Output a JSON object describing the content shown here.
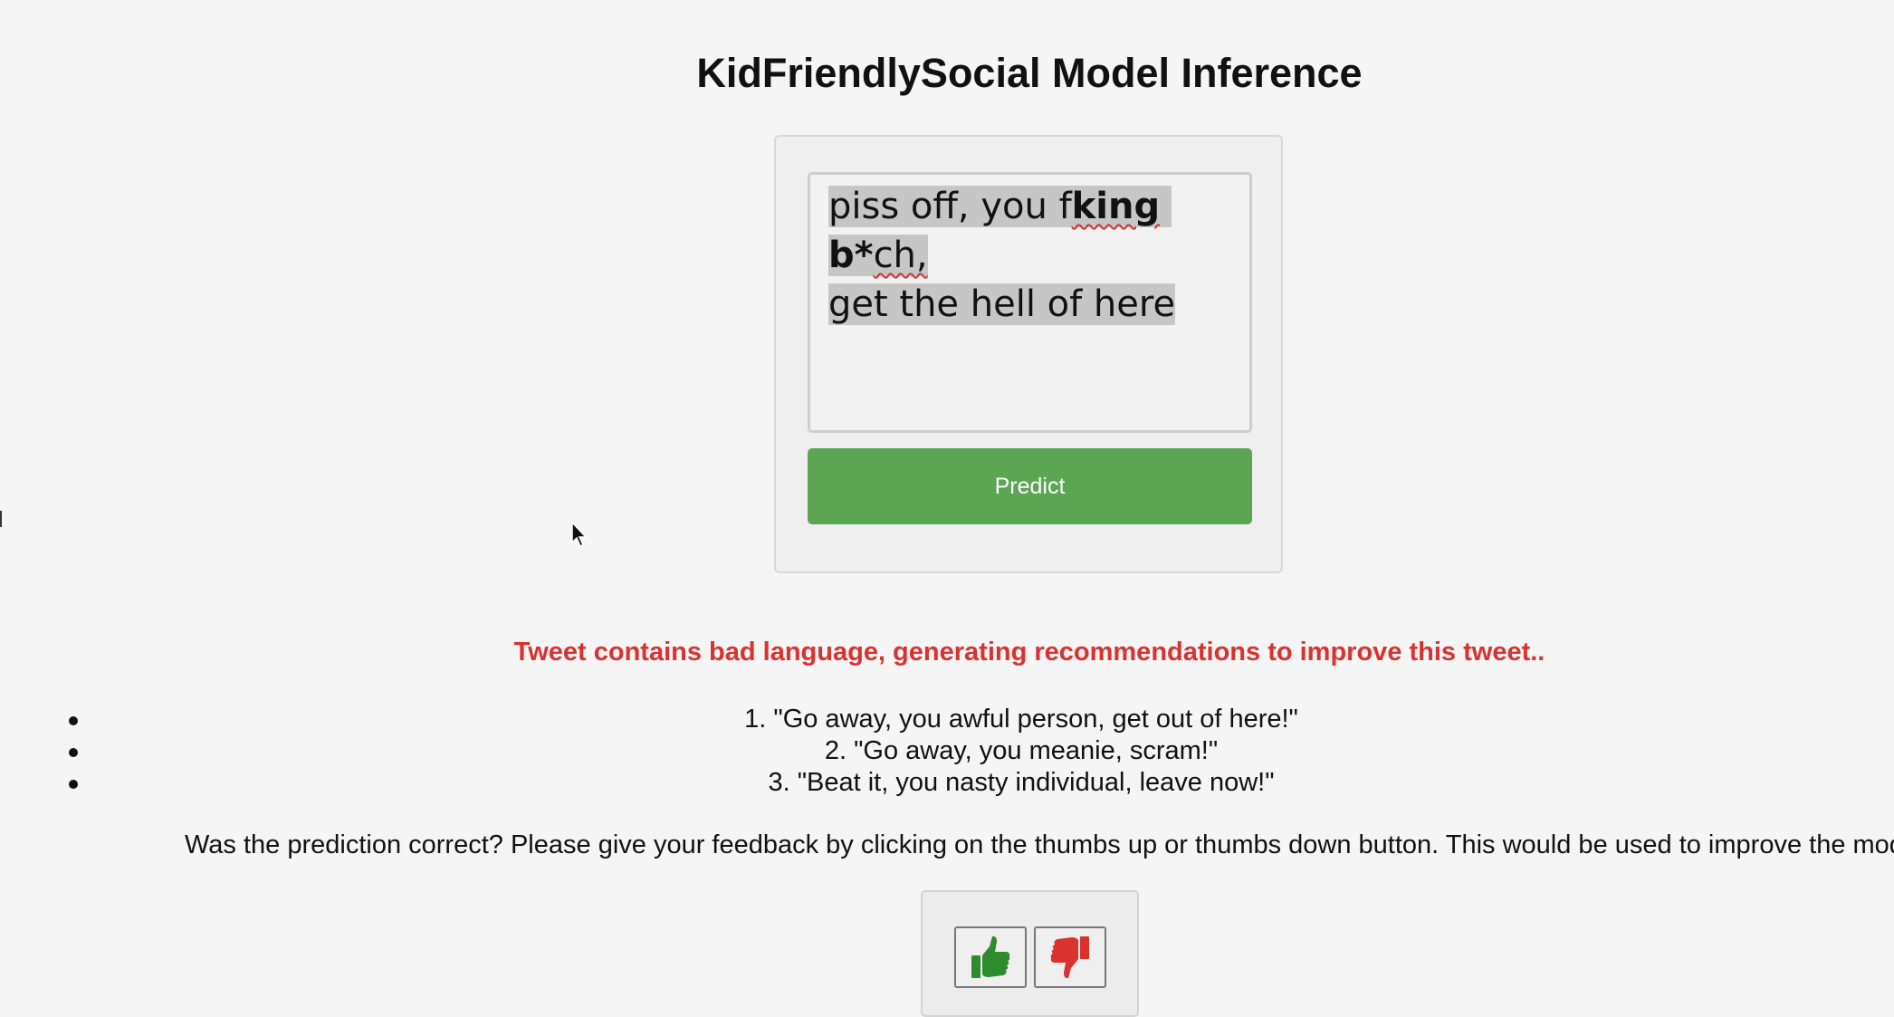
{
  "page": {
    "title": "KidFriendlySocial Model Inference"
  },
  "input": {
    "tweet_parts": [
      "piss off, you f",
      "king",
      " ",
      "b*",
      "ch,",
      "\nget the hell of here"
    ]
  },
  "form": {
    "predict_label": "Predict",
    "button_color": "#5ba553"
  },
  "result": {
    "status_message": "Tweet contains bad language, generating recommendations to improve this tweet..",
    "status_color": "#d9322f",
    "suggestions": [
      "1. \"Go away, you awful person, get out of here!\"",
      "2. \"Go away, you meanie, scram!\"",
      "3. \"Beat it, you nasty individual, leave now!\""
    ]
  },
  "feedback": {
    "prompt": "Was the prediction correct? Please give your feedback by clicking on the thumbs up or thumbs down button. This would be used to improve the model",
    "thumbs_up_icon": "thumbs-up-icon",
    "thumbs_up_color": "#2e8b2e",
    "thumbs_down_icon": "thumbs-down-icon",
    "thumbs_down_color": "#d9322f"
  }
}
